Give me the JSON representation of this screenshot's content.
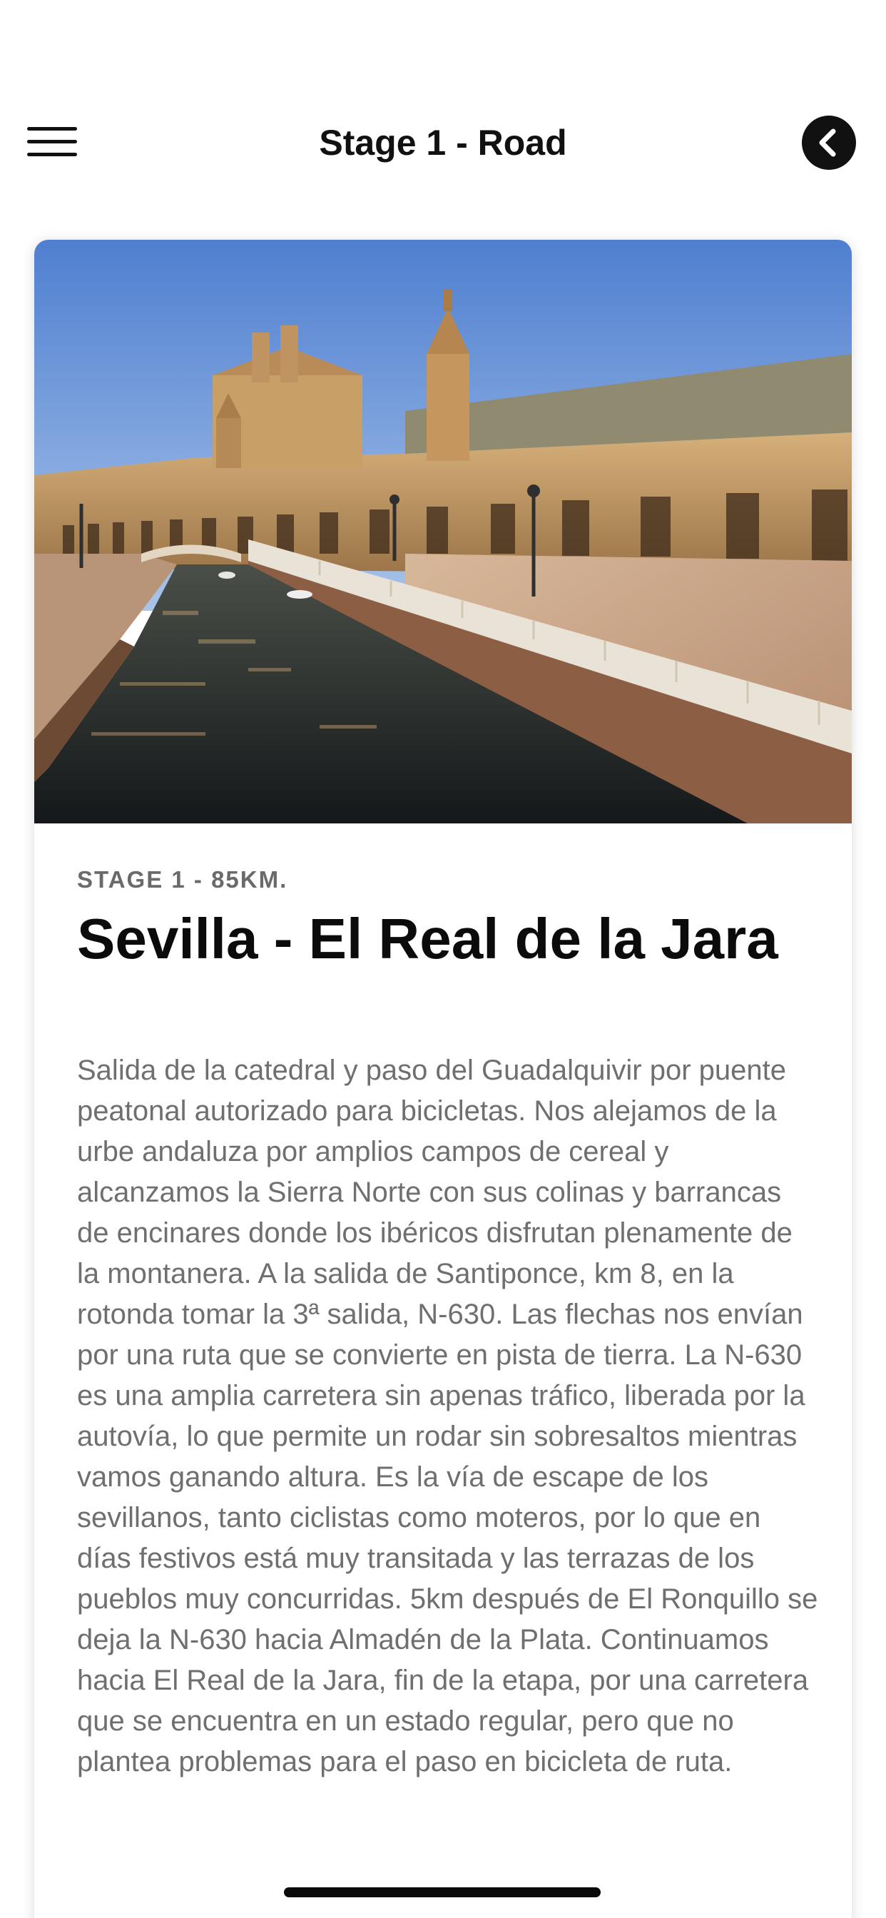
{
  "header": {
    "title": "Stage 1 - Road",
    "menu_icon": "hamburger-menu-icon",
    "back_icon": "chevron-left-circle-icon"
  },
  "card": {
    "image_description_icon": "sevilla-plaza-photo",
    "stage_label": "STAGE 1 - 85KM.",
    "title": "Sevilla - El Real de la Jara",
    "description": "Salida de la catedral y paso del Guadalquivir por puente peatonal autorizado para bicicletas. Nos alejamos de la urbe andaluza por amplios campos de cereal y alcanzamos la Sierra Norte con sus colinas y barrancas de encinares donde los ibéricos disfrutan plenamente de la montanera. A la salida de Santiponce, km 8, en la rotonda tomar la 3ª salida, N-630. Las flechas nos envían por una ruta que se convierte en pista de tierra. La N-630 es una amplia carretera sin apenas tráfico, liberada por la autovía, lo que permite un rodar sin sobresaltos mientras vamos ganando altura. Es la vía de escape de los sevillanos, tanto ciclistas como moteros, por lo que en días festivos está muy transitada y las terrazas de los pueblos muy concurridas. 5km después de El Ronquillo se deja la N-630 hacia Almadén de la Plata. Continuamos hacia El Real de la Jara, fin de la etapa, por una carretera que se encuentra en un estado regular, pero que no plantea problemas para el paso en bicicleta de ruta."
  },
  "colors": {
    "text_primary": "#111111",
    "text_secondary": "#6f6f6f",
    "sky": "#5f8ed8",
    "building": "#c9a46e",
    "water": "#2a2e2c"
  }
}
